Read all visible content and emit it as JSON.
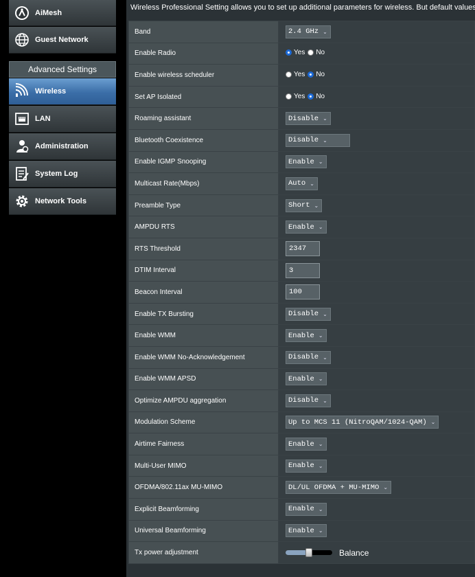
{
  "sidebar": {
    "top_items": [
      {
        "label": "AiMesh",
        "icon": "aimesh-icon"
      },
      {
        "label": "Guest Network",
        "icon": "globe-icon"
      }
    ],
    "section_header": "Advanced Settings",
    "items": [
      {
        "label": "Wireless",
        "icon": "wifi-icon",
        "active": true
      },
      {
        "label": "LAN",
        "icon": "lan-icon",
        "active": false
      },
      {
        "label": "Administration",
        "icon": "admin-icon",
        "active": false
      },
      {
        "label": "System Log",
        "icon": "system-log-icon",
        "active": false
      },
      {
        "label": "Network Tools",
        "icon": "gear-icon",
        "active": false
      }
    ]
  },
  "intro_text": "Wireless Professional Setting allows you to set up additional parameters for wireless. But default values a",
  "settings": [
    {
      "label": "Band",
      "type": "select",
      "value": "2.4 GHz"
    },
    {
      "label": "Enable Radio",
      "type": "radio",
      "options": [
        "Yes",
        "No"
      ],
      "selected": "Yes"
    },
    {
      "label": "Enable wireless scheduler",
      "type": "radio",
      "options": [
        "Yes",
        "No"
      ],
      "selected": "No"
    },
    {
      "label": "Set AP Isolated",
      "type": "radio",
      "options": [
        "Yes",
        "No"
      ],
      "selected": "No"
    },
    {
      "label": "Roaming assistant",
      "type": "select",
      "value": "Disable"
    },
    {
      "label": "Bluetooth Coexistence",
      "type": "select",
      "value": "Disable",
      "wide": true
    },
    {
      "label": "Enable IGMP Snooping",
      "type": "select",
      "value": "Enable"
    },
    {
      "label": "Multicast Rate(Mbps)",
      "type": "select",
      "value": "Auto"
    },
    {
      "label": "Preamble Type",
      "type": "select",
      "value": "Short"
    },
    {
      "label": "AMPDU RTS",
      "type": "select",
      "value": "Enable"
    },
    {
      "label": "RTS Threshold",
      "type": "text",
      "value": "2347"
    },
    {
      "label": "DTIM Interval",
      "type": "text",
      "value": "3"
    },
    {
      "label": "Beacon Interval",
      "type": "text",
      "value": "100"
    },
    {
      "label": "Enable TX Bursting",
      "type": "select",
      "value": "Disable"
    },
    {
      "label": "Enable WMM",
      "type": "select",
      "value": "Enable"
    },
    {
      "label": "Enable WMM No-Acknowledgement",
      "type": "select",
      "value": "Disable"
    },
    {
      "label": "Enable WMM APSD",
      "type": "select",
      "value": "Enable"
    },
    {
      "label": "Optimize AMPDU aggregation",
      "type": "select",
      "value": "Disable"
    },
    {
      "label": "Modulation Scheme",
      "type": "select",
      "value": "Up to MCS 11 (NitroQAM/1024-QAM)"
    },
    {
      "label": "Airtime Fairness",
      "type": "select",
      "value": "Enable"
    },
    {
      "label": "Multi-User MIMO",
      "type": "select",
      "value": "Enable"
    },
    {
      "label": "OFDMA/802.11ax MU-MIMO",
      "type": "select",
      "value": "DL/UL OFDMA + MU-MIMO"
    },
    {
      "label": "Explicit Beamforming",
      "type": "select",
      "value": "Enable"
    },
    {
      "label": "Universal Beamforming",
      "type": "select",
      "value": "Enable"
    },
    {
      "label": "Tx power adjustment",
      "type": "slider",
      "level": 0.5,
      "value_label": "Balance"
    }
  ],
  "colors": {
    "accent_blue": "#3b6ea8",
    "radio_selected": "#1c6ad8",
    "panel": "#2b3236"
  }
}
